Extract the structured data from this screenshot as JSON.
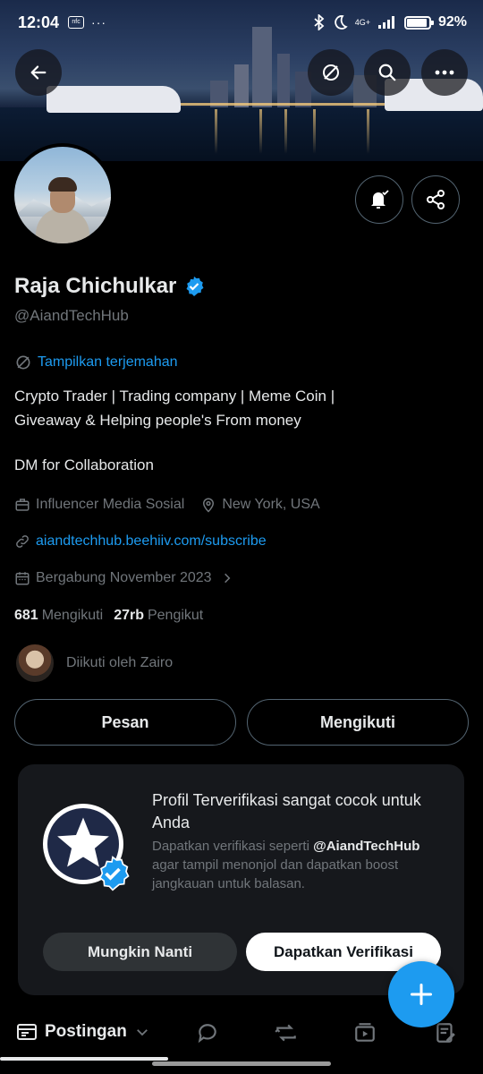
{
  "status_bar": {
    "time": "12:04",
    "nfc_label": "nfc",
    "more": "···",
    "network": "4G+",
    "battery": "92%",
    "battery_level": 0.92
  },
  "profile": {
    "name": "Raja Chichulkar",
    "handle": "@AiandTechHub",
    "translate_label": "Tampilkan terjemahan",
    "bio_lines": [
      "Crypto Trader | Trading company | Meme Coin |",
      "Giveaway & Helping people's From money"
    ],
    "bio_extra": "DM for Collaboration",
    "category": "Influencer Media Sosial",
    "location": "New York, USA",
    "website": "aiandtechhub.beehiiv.com/subscribe",
    "joined": "Bergabung November 2023",
    "following_count": "681",
    "following_label": "Mengikuti",
    "followers_count": "27rb",
    "followers_label": "Pengikut",
    "followed_by": "Diikuti oleh Zairo"
  },
  "actions": {
    "message_label": "Pesan",
    "following_label": "Mengikuti"
  },
  "verify_card": {
    "title": "Profil Terverifikasi sangat cocok untuk Anda",
    "desc_prefix": "Dapatkan verifikasi seperti",
    "desc_handle": "@AiandTechHub",
    "desc_suffix": "agar tampil menonjol dan dapatkan boost jangkauan untuk balasan.",
    "later_label": "Mungkin Nanti",
    "get_label": "Dapatkan Verifikasi"
  },
  "tabs": {
    "active_label": "Postingan"
  },
  "colors": {
    "accent": "#1d9bf0",
    "background": "#000000",
    "muted": "#71767b",
    "card": "#16181c"
  }
}
